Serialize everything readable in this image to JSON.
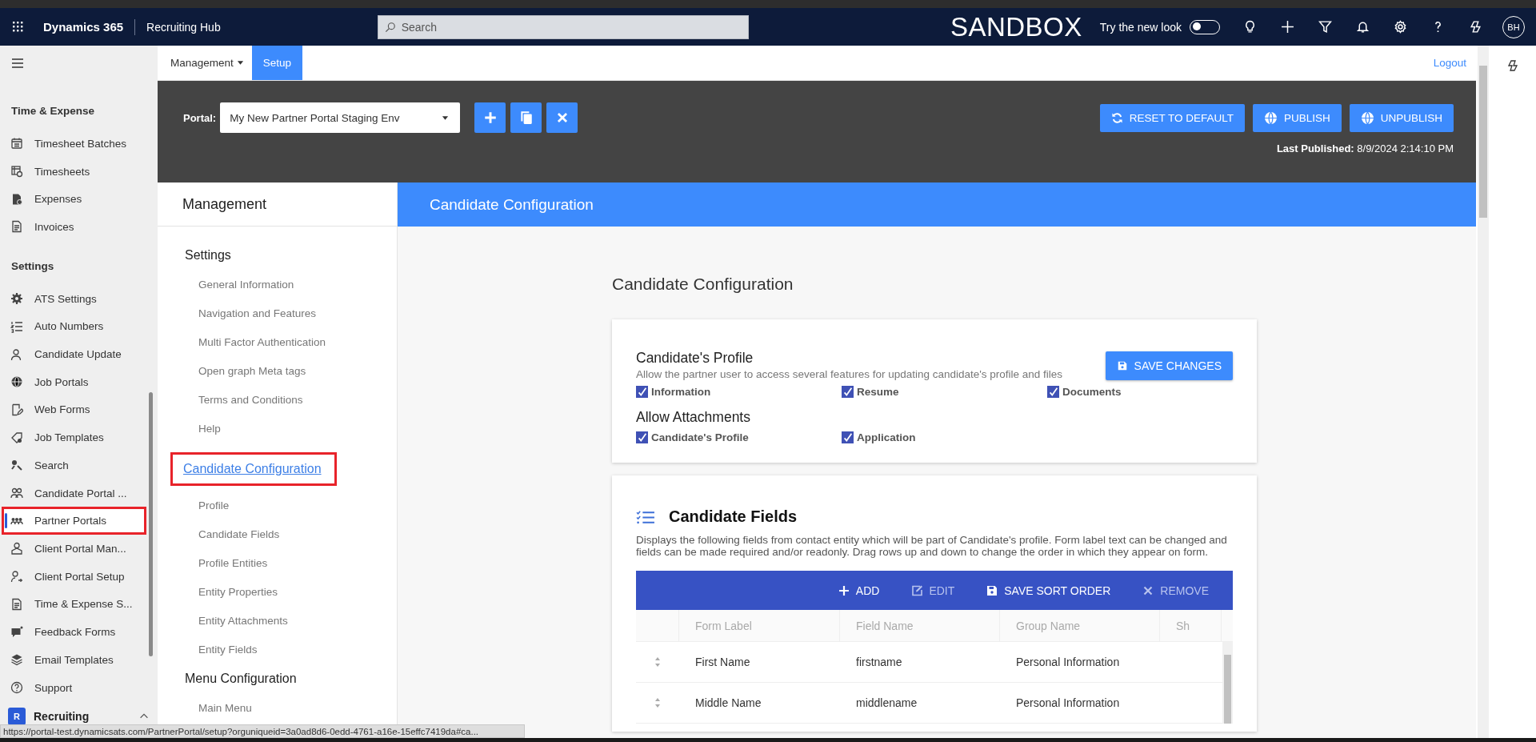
{
  "top_bar": {
    "app_name": "Dynamics 365",
    "area_name": "Recruiting Hub",
    "search": {
      "placeholder": "Search"
    },
    "environment": "SANDBOX",
    "new_look": {
      "label": "Try the new look",
      "on": false
    },
    "avatar": "BH"
  },
  "sidebar": {
    "sections": [
      {
        "title": "Time & Expense",
        "items": [
          {
            "label": "Timesheet Batches",
            "selected": false
          },
          {
            "label": "Timesheets",
            "selected": false
          },
          {
            "label": "Expenses",
            "selected": false
          },
          {
            "label": "Invoices",
            "selected": false
          }
        ]
      },
      {
        "title": "Settings",
        "items": [
          {
            "label": "ATS Settings",
            "selected": false
          },
          {
            "label": "Auto Numbers",
            "selected": false
          },
          {
            "label": "Candidate Update",
            "selected": false
          },
          {
            "label": "Job Portals",
            "selected": false
          },
          {
            "label": "Web Forms",
            "selected": false
          },
          {
            "label": "Job Templates",
            "selected": false
          },
          {
            "label": "Search",
            "selected": false
          },
          {
            "label": "Candidate Portal ...",
            "selected": false
          },
          {
            "label": "Partner Portals",
            "selected": true,
            "highlighted": true
          },
          {
            "label": "Client Portal Man...",
            "selected": false
          },
          {
            "label": "Client Portal Setup",
            "selected": false
          },
          {
            "label": "Time & Expense S...",
            "selected": false
          },
          {
            "label": "Feedback Forms",
            "selected": false
          },
          {
            "label": "Email Templates",
            "selected": false
          },
          {
            "label": "Support",
            "selected": false
          }
        ]
      }
    ],
    "area_switcher": {
      "badge": "R",
      "label": "Recruiting"
    }
  },
  "tabs": [
    {
      "label": "Management",
      "selected": false,
      "has_menu": true
    },
    {
      "label": "Setup",
      "selected": true,
      "has_menu": false
    }
  ],
  "logout": "Logout",
  "portal_bar": {
    "label": "Portal:",
    "value": "My New Partner Portal Staging Env",
    "actions": [
      {
        "label": "RESET TO DEFAULT",
        "kind": "reset"
      },
      {
        "label": "PUBLISH",
        "kind": "globe"
      },
      {
        "label": "UNPUBLISH",
        "kind": "globe"
      }
    ],
    "last_published_label": "Last Published:",
    "last_published": "8/9/2024 2:14:10 PM"
  },
  "management": {
    "title": "Management",
    "groups": [
      {
        "title": "Settings",
        "kind": "heading",
        "highlighted": false,
        "items": [
          "General Information",
          "Navigation and Features",
          "Multi Factor Authentication",
          "Open graph Meta tags",
          "Terms and Conditions",
          "Help"
        ]
      },
      {
        "title": "Candidate Configuration",
        "kind": "link",
        "highlighted": true,
        "items": [
          "Profile",
          "Candidate Fields",
          "Profile Entities",
          "Entity Properties",
          "Entity Attachments",
          "Entity Fields"
        ]
      },
      {
        "title": "Menu Configuration",
        "kind": "heading",
        "highlighted": false,
        "items": [
          "Main Menu"
        ]
      }
    ]
  },
  "page_header": "Candidate Configuration",
  "heading": "Candidate Configuration",
  "profile_card": {
    "title": "Candidate's Profile",
    "description": "Allow the partner user to access several features for updating candidate's profile and files",
    "save_button": "SAVE CHANGES",
    "options": [
      {
        "label": "Information",
        "checked": true
      },
      {
        "label": "Resume",
        "checked": true
      },
      {
        "label": "Documents",
        "checked": true
      }
    ],
    "attachments_title": "Allow Attachments",
    "attachments": [
      {
        "label": "Candidate's Profile",
        "checked": true
      },
      {
        "label": "Application",
        "checked": true
      }
    ]
  },
  "fields_card": {
    "title": "Candidate Fields",
    "description": "Displays the following fields from contact entity which will be part of Candidate's profile. Form label text can be changed and fields can be made required and/or readonly. Drag rows up and down to change the order in which they appear on form.",
    "toolbar": [
      {
        "label": "ADD",
        "kind": "add",
        "disabled": false
      },
      {
        "label": "EDIT",
        "kind": "edit",
        "disabled": true
      },
      {
        "label": "SAVE SORT ORDER",
        "kind": "save",
        "disabled": false
      },
      {
        "label": "REMOVE",
        "kind": "remove",
        "disabled": true
      }
    ],
    "columns": [
      "Form Label",
      "Field Name",
      "Group Name",
      "Sh"
    ],
    "rows": [
      [
        "First Name",
        "firstname",
        "Personal Information"
      ],
      [
        "Middle Name",
        "middlename",
        "Personal Information"
      ]
    ]
  },
  "status_url": "https://portal-test.dynamicsats.com/PartnerPortal/setup?orguniqueid=3a0ad8d6-0edd-4761-a16e-15effc7419da#ca..."
}
